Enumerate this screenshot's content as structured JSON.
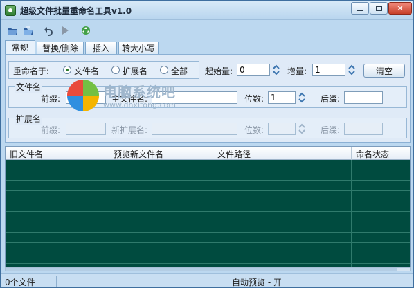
{
  "window": {
    "title": "超级文件批量重命名工具v1.0"
  },
  "toolbar": {
    "icons": [
      "open-folder-icon",
      "open-files-icon",
      "undo-icon",
      "run-icon",
      "recycle-icon"
    ]
  },
  "tabs": [
    "常规",
    "替换/删除",
    "插入",
    "转大小写"
  ],
  "rename": {
    "label": "重命名于:",
    "options": [
      "文件名",
      "扩展名",
      "全部"
    ],
    "selected": "文件名"
  },
  "counter": {
    "start_label": "起始量:",
    "start_value": "0",
    "step_label": "增量:",
    "step_value": "1",
    "clear_label": "清空"
  },
  "filename_group": {
    "legend": "文件名",
    "prefix_label": "前缀:",
    "main_label": "主文件名:",
    "digits_label": "位数:",
    "digits_value": "1",
    "suffix_label": "后缀:"
  },
  "ext_group": {
    "legend": "扩展名",
    "prefix_label": "前缀:",
    "new_ext_label": "新扩展名:",
    "digits_label": "位数:",
    "suffix_label": "后缀:"
  },
  "watermark": {
    "text": "电脑系统吧",
    "url": "www.dnxitong.com"
  },
  "table": {
    "columns": [
      "旧文件名",
      "预览新文件名",
      "文件路径",
      "命名状态"
    ]
  },
  "status": {
    "count": "0个文件",
    "preview": "自动预览 - 开"
  }
}
